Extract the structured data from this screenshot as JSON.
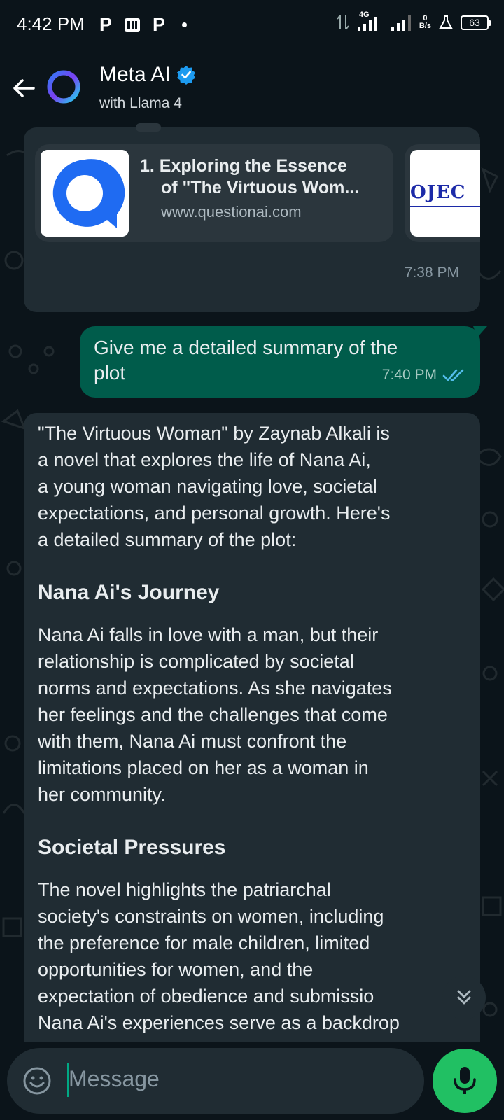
{
  "status_bar": {
    "time": "4:42 PM",
    "network": "4G",
    "data_rate_value": "0",
    "data_rate_unit": "B/s",
    "battery": "63"
  },
  "header": {
    "title": "Meta AI",
    "subtitle": "with Llama 4"
  },
  "messages": {
    "link_preview": {
      "cards": [
        {
          "title_line1": "1. Exploring the Essence",
          "title_line2": "of \"The Virtuous Wom...",
          "url": "www.questionai.com"
        },
        {
          "thumb_text": "OJEC"
        }
      ],
      "time": "7:38 PM"
    },
    "user_message": {
      "line1": "Give me a detailed summary of the",
      "line2": "plot",
      "time": "7:40 PM"
    },
    "ai_reply": {
      "intro": [
        "\"The Virtuous Woman\" by Zaynab Alkali is",
        "a novel that explores the life of Nana Ai,",
        "a young woman navigating love, societal",
        "expectations, and personal growth. Here's",
        "a detailed summary of the plot:"
      ],
      "heading1": "Nana Ai's Journey",
      "para1": [
        "Nana Ai falls in love with a man, but their",
        "relationship is complicated by societal",
        "norms and expectations. As she navigates",
        "her feelings and the challenges that come",
        "with them, Nana Ai must confront the",
        "limitations placed on her as a woman in",
        "her community."
      ],
      "heading2": "Societal Pressures",
      "para2": [
        "The novel highlights the patriarchal",
        "society's constraints on women, including",
        "the preference for male children, limited",
        "opportunities for women, and the",
        "expectation of obedience and submissio",
        "Nana Ai's experiences serve as a backdrop"
      ]
    }
  },
  "input": {
    "placeholder": "Message"
  },
  "colors": {
    "background": "#0b141a",
    "incoming_bubble": "#202c33",
    "outgoing_bubble": "#005c4b",
    "accent": "#00a884",
    "mic_button": "#21c063",
    "read_ticks": "#53bdeb"
  },
  "icons": [
    "back-arrow-icon",
    "meta-ai-ring-icon",
    "verified-badge-icon",
    "double-check-icon",
    "chevron-double-down-icon",
    "emoji-icon",
    "microphone-icon"
  ]
}
